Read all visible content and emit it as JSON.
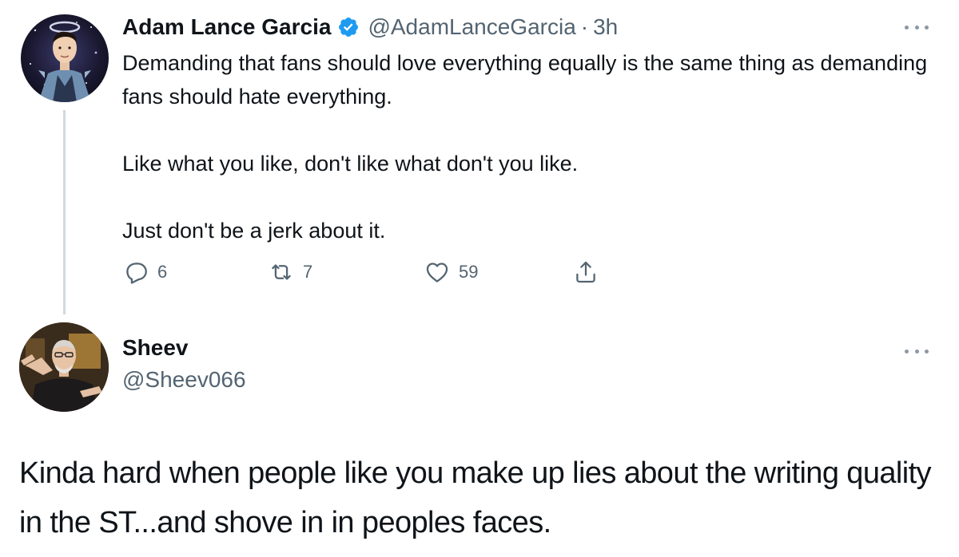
{
  "colors": {
    "text_primary": "#0f1419",
    "text_secondary": "#536471",
    "verified_blue": "#1d9bf0",
    "thread_line": "#cfd9de"
  },
  "tweet1": {
    "avatar_icon": "profile-photo",
    "display_name": "Adam Lance Garcia",
    "verified": true,
    "handle": "@AdamLanceGarcia",
    "separator": "·",
    "time": "3h",
    "more_icon": "ellipsis-icon",
    "body": [
      "Demanding that fans should love everything equally is the same thing as demanding fans should hate everything.",
      "Like what you like, don't like what don't you like.",
      "Just don't be a jerk about it."
    ],
    "actions": {
      "reply_count": "6",
      "retweet_count": "7",
      "like_count": "59"
    }
  },
  "tweet2": {
    "avatar_icon": "profile-photo",
    "display_name": "Sheev",
    "handle": "@Sheev066",
    "more_icon": "ellipsis-icon",
    "body": "Kinda hard when people like you make up lies about the writing quality in the ST...and shove in in peoples faces."
  }
}
